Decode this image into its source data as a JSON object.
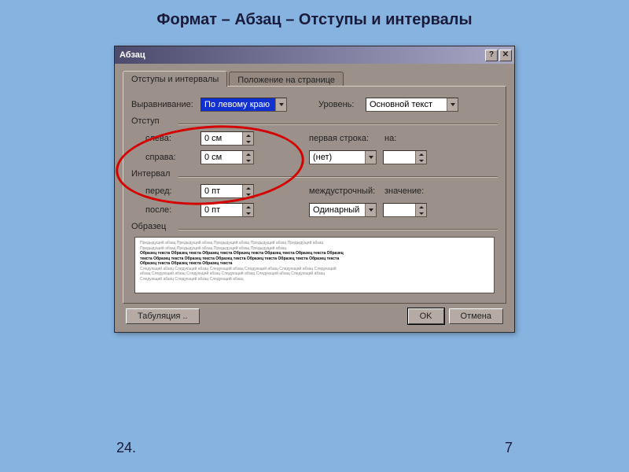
{
  "slide": {
    "title": "Формат – Абзац – Отступы и интервалы",
    "footer_left": "24.",
    "footer_right": "7"
  },
  "dialog": {
    "title": "Абзац",
    "help_btn": "?",
    "close_btn": "✕"
  },
  "tabs": {
    "active": "Отступы и интервалы",
    "inactive": "Положение на странице"
  },
  "align": {
    "label": "Выравнивание:",
    "value": "По левому краю"
  },
  "level": {
    "label": "Уровень:",
    "value": "Основной текст"
  },
  "indent": {
    "group": "Отступ",
    "left_label": "слева:",
    "left_value": "0 см",
    "right_label": "справа:",
    "right_value": "0 см",
    "firstline_label": "первая строка:",
    "firstline_value": "(нет)",
    "by_label": "на:",
    "by_value": ""
  },
  "spacing": {
    "group": "Интервал",
    "before_label": "перед:",
    "before_value": "0 пт",
    "after_label": "после:",
    "after_value": "0 пт",
    "line_label": "междустрочный:",
    "line_value": "Одинарный",
    "at_label": "значение:",
    "at_value": ""
  },
  "preview": {
    "label": "Образец",
    "gray1": "Предыдущий абзац Предыдущий абзац Предыдущий абзац Предыдущий абзац Предыдущий абзац",
    "gray2": "Предыдущий абзац Предыдущий абзац Предыдущий абзац Предыдущий абзац",
    "bold1": "Образец текста Образец текста Образец текста Образец текста Образец текста Образец текста Образец",
    "bold2": "текста Образец текста Образец текста Образец текста Образец текста Образец текста Образец текста",
    "bold3": "Образец текста Образец текста Образец текста",
    "gray3": "Следующий абзац Следующий абзац Следующий абзац Следующий абзац Следующий абзац Следующий",
    "gray4": "абзац Следующий абзац Следующий абзац Следующий абзац Следующий абзац Следующий абзац",
    "gray5": "Следующий абзац Следующий абзац Следующий абзац"
  },
  "buttons": {
    "tabs": "Табуляция ..",
    "ok": "OK",
    "cancel": "Отмена"
  }
}
